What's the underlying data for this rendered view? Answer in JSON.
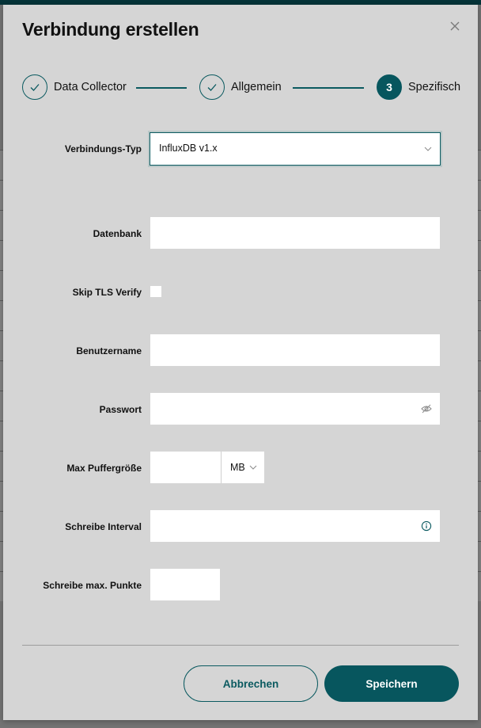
{
  "dialog": {
    "title": "Verbindung erstellen",
    "close_icon": "close-icon"
  },
  "stepper": {
    "steps": [
      {
        "label": "Data Collector",
        "state": "completed",
        "icon": "check-icon"
      },
      {
        "label": "Allgemein",
        "state": "completed",
        "icon": "check-icon"
      },
      {
        "label": "Spezifisch",
        "state": "active",
        "number": "3"
      }
    ]
  },
  "form": {
    "connection_type": {
      "label": "Verbindungs-Typ",
      "value": "InfluxDB v1.x",
      "icon": "chevron-down-icon"
    },
    "database": {
      "label": "Datenbank",
      "value": ""
    },
    "skip_tls_verify": {
      "label": "Skip TLS Verify",
      "checked": false
    },
    "username": {
      "label": "Benutzername",
      "value": ""
    },
    "password": {
      "label": "Passwort",
      "value": "",
      "icon": "eye-off-icon"
    },
    "max_buffer_size": {
      "label": "Max Puffergröße",
      "value": "",
      "unit": "MB",
      "unit_icon": "chevron-down-icon"
    },
    "write_interval": {
      "label": "Schreibe Interval",
      "value": "",
      "icon": "info-icon"
    },
    "write_max_points": {
      "label": "Schreibe max. Punkte",
      "value": ""
    }
  },
  "footer": {
    "cancel_label": "Abbrechen",
    "save_label": "Speichern"
  },
  "colors": {
    "primary": "#07565e",
    "dialog_bg": "#d5d5d5",
    "top_bar": "#053338"
  }
}
